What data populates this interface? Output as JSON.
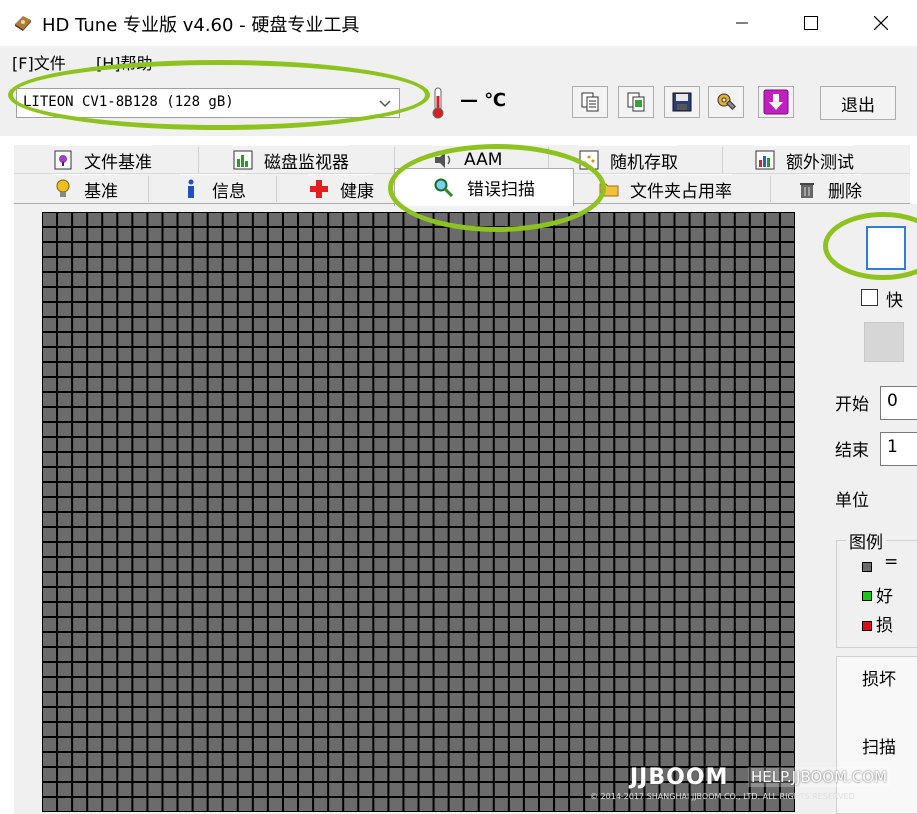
{
  "window": {
    "title": "HD Tune 专业版 v4.60 - 硬盘专业工具",
    "minimize_icon": "minimize-icon",
    "maximize_icon": "maximize-icon",
    "close_icon": "close-icon"
  },
  "menu": {
    "file": "[F]文件",
    "help": "[H]帮助"
  },
  "toolbar": {
    "drive": "LITEON CV1-8B128 (128 gB)",
    "temperature": "— ℃",
    "buttons": [
      "copy-text-icon",
      "copy-screenshot-icon",
      "save-icon",
      "options-icon",
      "download-icon"
    ],
    "exit_label": "退出"
  },
  "tabs": {
    "row1": [
      "文件基准",
      "磁盘监视器",
      "AAM",
      "随机存取",
      "额外测试"
    ],
    "row2": [
      "基准",
      "信息",
      "健康",
      "错误扫描",
      "文件夹占用率",
      "删除"
    ],
    "active": "错误扫描"
  },
  "panel": {
    "quick_scan_label": "快",
    "start_label": "开始",
    "start_value": "0",
    "end_label": "结束",
    "end_value": "1",
    "unit_label": "单位",
    "legend_title": "图例",
    "legend_items": [
      {
        "label": "=",
        "color": "#6b6b6b"
      },
      {
        "label": "好",
        "color": "#19c819"
      },
      {
        "label": "损",
        "color": "#e01010"
      }
    ],
    "stats_damaged": "损坏",
    "stats_scanned": "扫描"
  },
  "colors": {
    "cell": "#6b6b6b",
    "highlight": "#8dc21f",
    "accent": "#2f7fd8"
  },
  "watermark": {
    "logo": "JJBOOM",
    "url": "HELP.JJBOOM.COM",
    "copyright": "© 2014-2017 SHANGHAI JJBOOM CO., LTD. ALL RIGHTS RESERVED"
  }
}
